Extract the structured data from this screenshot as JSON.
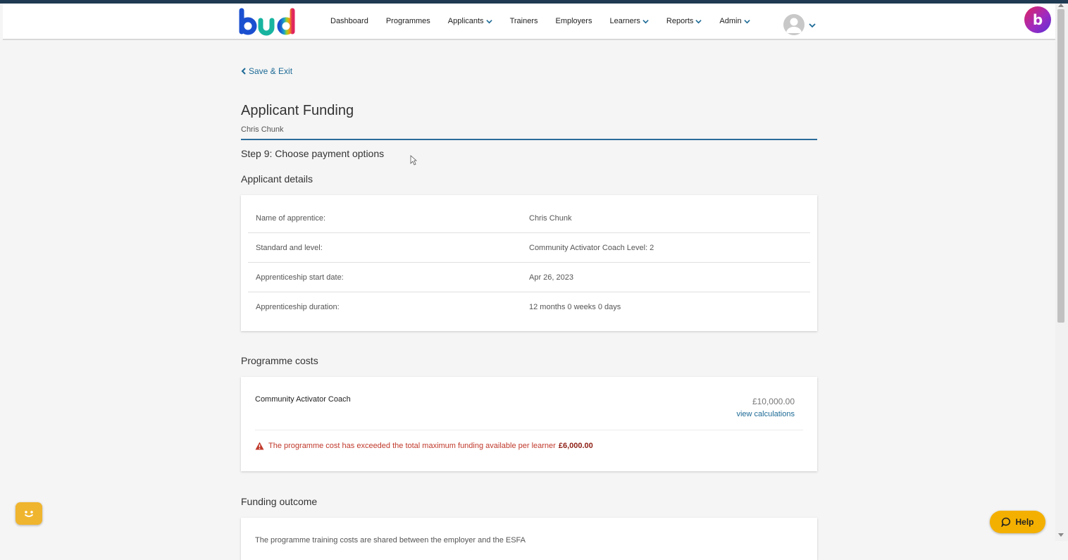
{
  "nav": {
    "logo_text": "bud",
    "items": [
      {
        "label": "Dashboard",
        "dropdown": false
      },
      {
        "label": "Programmes",
        "dropdown": false
      },
      {
        "label": "Applicants",
        "dropdown": true
      },
      {
        "label": "Trainers",
        "dropdown": false
      },
      {
        "label": "Employers",
        "dropdown": false
      },
      {
        "label": "Learners",
        "dropdown": true
      },
      {
        "label": "Reports",
        "dropdown": true
      },
      {
        "label": "Admin",
        "dropdown": true
      }
    ],
    "brand_letter": "b"
  },
  "page": {
    "back_label": "Save & Exit",
    "title": "Applicant Funding",
    "subtitle": "Chris Chunk",
    "step": "Step 9: Choose payment options"
  },
  "applicant_details": {
    "heading": "Applicant details",
    "rows": [
      {
        "label": "Name of apprentice:",
        "value": "Chris Chunk"
      },
      {
        "label": "Standard and level:",
        "value": "Community Activator Coach Level: 2"
      },
      {
        "label": "Apprenticeship start date:",
        "value": "Apr 26, 2023"
      },
      {
        "label": "Apprenticeship duration:",
        "value": "12 months 0 weeks 0 days"
      }
    ]
  },
  "programme_costs": {
    "heading": "Programme costs",
    "name": "Community Activator Coach",
    "amount": "£10,000.00",
    "view_calc_label": "view calculations",
    "warning_text": "The programme cost has exceeded the total maximum funding available per learner",
    "warning_amount": "£6,000.00"
  },
  "funding_outcome": {
    "heading": "Funding outcome",
    "text": "The programme training costs are shared between the employer and the ESFA"
  },
  "help": {
    "label": "Help"
  },
  "colors": {
    "accent": "#1d6a96",
    "warning": "#c0392b",
    "help": "#f4b000"
  }
}
